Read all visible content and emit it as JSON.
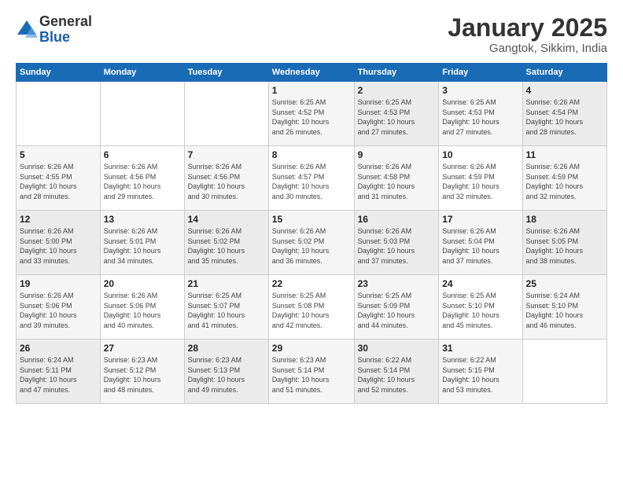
{
  "logo": {
    "general": "General",
    "blue": "Blue"
  },
  "header": {
    "title": "January 2025",
    "subtitle": "Gangtok, Sikkim, India"
  },
  "weekdays": [
    "Sunday",
    "Monday",
    "Tuesday",
    "Wednesday",
    "Thursday",
    "Friday",
    "Saturday"
  ],
  "weeks": [
    [
      {
        "day": "",
        "info": ""
      },
      {
        "day": "",
        "info": ""
      },
      {
        "day": "",
        "info": ""
      },
      {
        "day": "1",
        "info": "Sunrise: 6:25 AM\nSunset: 4:52 PM\nDaylight: 10 hours\nand 26 minutes."
      },
      {
        "day": "2",
        "info": "Sunrise: 6:25 AM\nSunset: 4:53 PM\nDaylight: 10 hours\nand 27 minutes."
      },
      {
        "day": "3",
        "info": "Sunrise: 6:25 AM\nSunset: 4:53 PM\nDaylight: 10 hours\nand 27 minutes."
      },
      {
        "day": "4",
        "info": "Sunrise: 6:26 AM\nSunset: 4:54 PM\nDaylight: 10 hours\nand 28 minutes."
      }
    ],
    [
      {
        "day": "5",
        "info": "Sunrise: 6:26 AM\nSunset: 4:55 PM\nDaylight: 10 hours\nand 28 minutes."
      },
      {
        "day": "6",
        "info": "Sunrise: 6:26 AM\nSunset: 4:56 PM\nDaylight: 10 hours\nand 29 minutes."
      },
      {
        "day": "7",
        "info": "Sunrise: 6:26 AM\nSunset: 4:56 PM\nDaylight: 10 hours\nand 30 minutes."
      },
      {
        "day": "8",
        "info": "Sunrise: 6:26 AM\nSunset: 4:57 PM\nDaylight: 10 hours\nand 30 minutes."
      },
      {
        "day": "9",
        "info": "Sunrise: 6:26 AM\nSunset: 4:58 PM\nDaylight: 10 hours\nand 31 minutes."
      },
      {
        "day": "10",
        "info": "Sunrise: 6:26 AM\nSunset: 4:59 PM\nDaylight: 10 hours\nand 32 minutes."
      },
      {
        "day": "11",
        "info": "Sunrise: 6:26 AM\nSunset: 4:59 PM\nDaylight: 10 hours\nand 32 minutes."
      }
    ],
    [
      {
        "day": "12",
        "info": "Sunrise: 6:26 AM\nSunset: 5:00 PM\nDaylight: 10 hours\nand 33 minutes."
      },
      {
        "day": "13",
        "info": "Sunrise: 6:26 AM\nSunset: 5:01 PM\nDaylight: 10 hours\nand 34 minutes."
      },
      {
        "day": "14",
        "info": "Sunrise: 6:26 AM\nSunset: 5:02 PM\nDaylight: 10 hours\nand 35 minutes."
      },
      {
        "day": "15",
        "info": "Sunrise: 6:26 AM\nSunset: 5:02 PM\nDaylight: 10 hours\nand 36 minutes."
      },
      {
        "day": "16",
        "info": "Sunrise: 6:26 AM\nSunset: 5:03 PM\nDaylight: 10 hours\nand 37 minutes."
      },
      {
        "day": "17",
        "info": "Sunrise: 6:26 AM\nSunset: 5:04 PM\nDaylight: 10 hours\nand 37 minutes."
      },
      {
        "day": "18",
        "info": "Sunrise: 6:26 AM\nSunset: 5:05 PM\nDaylight: 10 hours\nand 38 minutes."
      }
    ],
    [
      {
        "day": "19",
        "info": "Sunrise: 6:26 AM\nSunset: 5:06 PM\nDaylight: 10 hours\nand 39 minutes."
      },
      {
        "day": "20",
        "info": "Sunrise: 6:26 AM\nSunset: 5:06 PM\nDaylight: 10 hours\nand 40 minutes."
      },
      {
        "day": "21",
        "info": "Sunrise: 6:25 AM\nSunset: 5:07 PM\nDaylight: 10 hours\nand 41 minutes."
      },
      {
        "day": "22",
        "info": "Sunrise: 6:25 AM\nSunset: 5:08 PM\nDaylight: 10 hours\nand 42 minutes."
      },
      {
        "day": "23",
        "info": "Sunrise: 6:25 AM\nSunset: 5:09 PM\nDaylight: 10 hours\nand 44 minutes."
      },
      {
        "day": "24",
        "info": "Sunrise: 6:25 AM\nSunset: 5:10 PM\nDaylight: 10 hours\nand 45 minutes."
      },
      {
        "day": "25",
        "info": "Sunrise: 6:24 AM\nSunset: 5:10 PM\nDaylight: 10 hours\nand 46 minutes."
      }
    ],
    [
      {
        "day": "26",
        "info": "Sunrise: 6:24 AM\nSunset: 5:11 PM\nDaylight: 10 hours\nand 47 minutes."
      },
      {
        "day": "27",
        "info": "Sunrise: 6:23 AM\nSunset: 5:12 PM\nDaylight: 10 hours\nand 48 minutes."
      },
      {
        "day": "28",
        "info": "Sunrise: 6:23 AM\nSunset: 5:13 PM\nDaylight: 10 hours\nand 49 minutes."
      },
      {
        "day": "29",
        "info": "Sunrise: 6:23 AM\nSunset: 5:14 PM\nDaylight: 10 hours\nand 51 minutes."
      },
      {
        "day": "30",
        "info": "Sunrise: 6:22 AM\nSunset: 5:14 PM\nDaylight: 10 hours\nand 52 minutes."
      },
      {
        "day": "31",
        "info": "Sunrise: 6:22 AM\nSunset: 5:15 PM\nDaylight: 10 hours\nand 53 minutes."
      },
      {
        "day": "",
        "info": ""
      }
    ]
  ]
}
